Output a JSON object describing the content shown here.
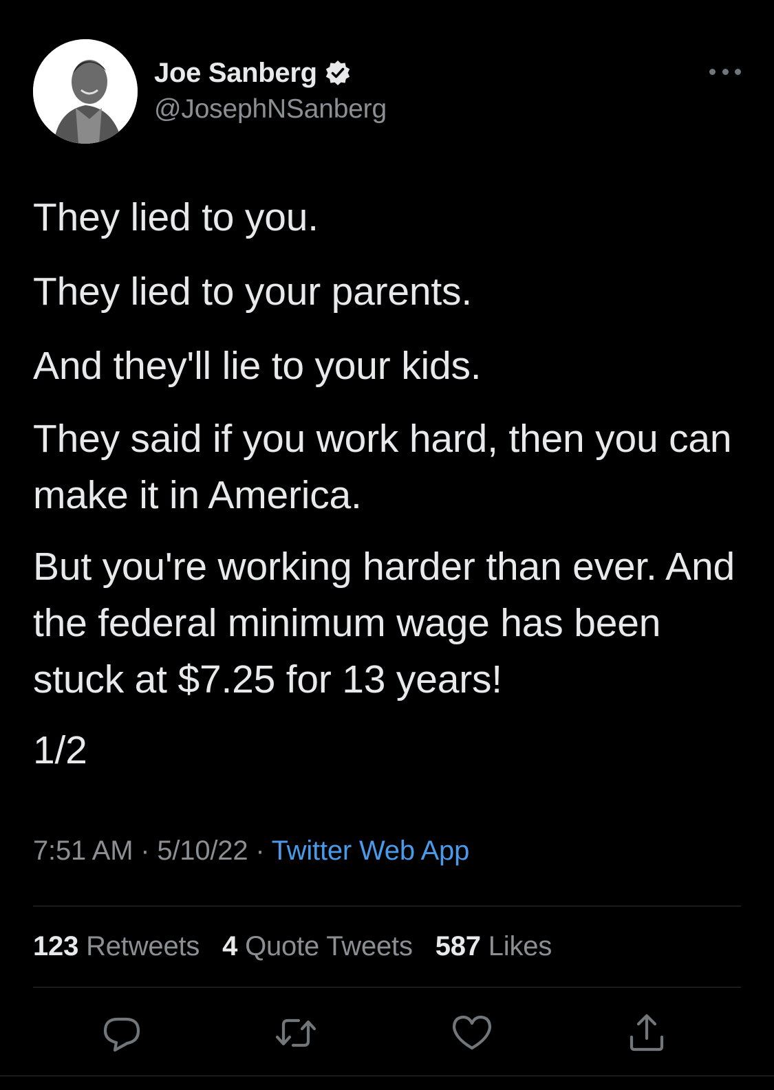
{
  "author": {
    "display_name": "Joe Sanberg",
    "handle": "@JosephNSanberg",
    "verified": true
  },
  "tweet": {
    "paragraphs": [
      "They lied to you.",
      "They lied to your parents.",
      "And they'll lie to your kids.",
      "They said if you work hard, then you can make it in America.",
      "But you're working harder than ever. And the federal minimum wage has been stuck at $7.25 for 13 years!",
      "1/2"
    ]
  },
  "meta": {
    "time": "7:51 AM",
    "separator": "·",
    "date": "5/10/22",
    "source": "Twitter Web App"
  },
  "stats": {
    "retweets_count": "123",
    "retweets_label": "Retweets",
    "quotes_count": "4",
    "quotes_label": "Quote Tweets",
    "likes_count": "587",
    "likes_label": "Likes"
  },
  "actions": {
    "reply_icon": "reply-icon",
    "retweet_icon": "retweet-icon",
    "like_icon": "heart-icon",
    "share_icon": "share-icon"
  },
  "colors": {
    "background": "#000000",
    "text": "#e7e9ea",
    "secondary_text": "#8b8f93",
    "link": "#4a9ae9",
    "divider": "#2f3336"
  }
}
